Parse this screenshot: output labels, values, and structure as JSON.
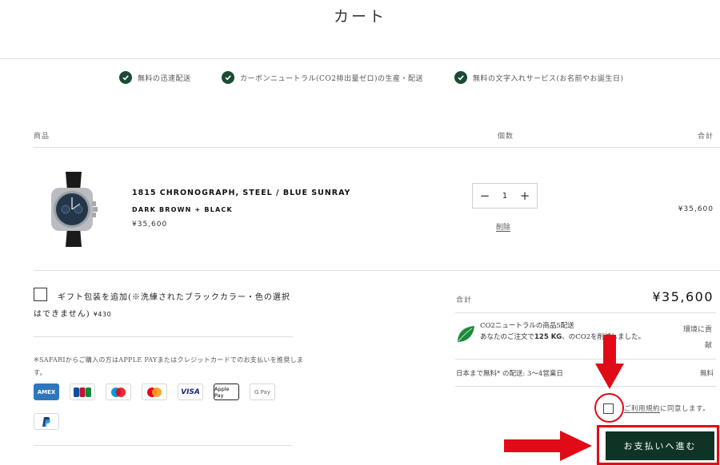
{
  "page": {
    "title": "カート"
  },
  "benefits": [
    {
      "icon": "check-circle-icon",
      "label": "無料の迅速配送"
    },
    {
      "icon": "check-circle-icon",
      "label": "カーボンニュートラル(CO2排出量ゼロ)の生産・配送"
    },
    {
      "icon": "check-circle-icon",
      "label": "無料の文字入れサービス(お名前やお誕生日)"
    }
  ],
  "table_headers": {
    "product": "商品",
    "quantity": "個数",
    "total": "合計"
  },
  "item": {
    "name": "1815 CHRONOGRAPH, STEEL / BLUE SUNRAY",
    "variant": "DARK BROWN + BLACK",
    "price": "¥35,600",
    "quantity": "1",
    "remove_label": "削除",
    "line_total": "¥35,600"
  },
  "gift": {
    "label": "ギフト包装を追加(※洗練されたブラックカラー・色の選択はできません)",
    "price": "¥430"
  },
  "payment": {
    "note": "※SAFARIからご購入の方はAPPLE PAYまたはクレジットカードでのお支払いを推奨します。",
    "methods": [
      "AMEX",
      "JCB",
      "Maestro",
      "Mastercard",
      "VISA",
      "Apple Pay",
      "G Pay",
      "PayPal"
    ]
  },
  "summary": {
    "subtotal_label": "合計",
    "subtotal_value": "¥35,600",
    "co2_line1": "CO2ニュートラルの商品5配送",
    "co2_line2_pre": "あなたのご注文で",
    "co2_amount": "125 KG",
    "co2_line2_post": "、のCO2を削減しました。",
    "co2_right": "環境に貢献",
    "shipping_label": "日本まで無料* の配送: 3～4営業日",
    "shipping_value": "無料"
  },
  "terms": {
    "link": "ご利用規約",
    "suffix": "に同意します。"
  },
  "checkout": {
    "label": "お支払いへ進む"
  },
  "colors": {
    "brand_green": "#0f3324",
    "check_green": "#1c4a34",
    "annotation_red": "#e10b17"
  }
}
